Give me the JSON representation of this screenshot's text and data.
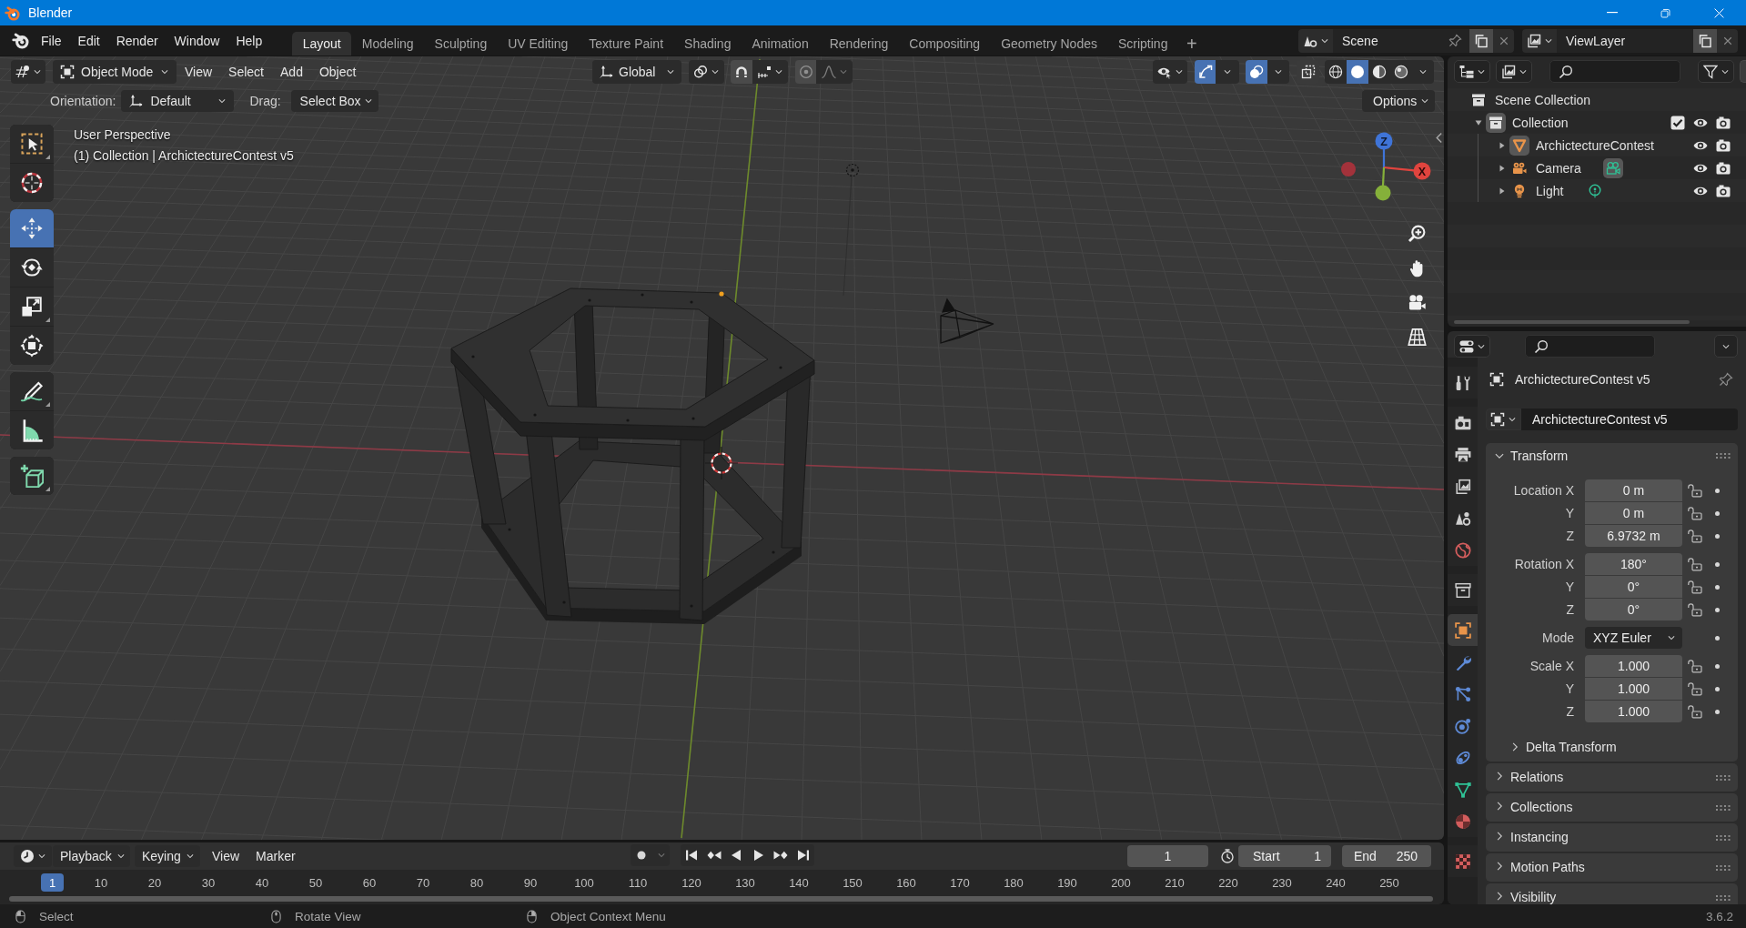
{
  "window": {
    "title": "Blender"
  },
  "menu": [
    "File",
    "Edit",
    "Render",
    "Window",
    "Help"
  ],
  "workspaces": [
    {
      "label": "Layout",
      "selected": true
    },
    {
      "label": "Modeling",
      "selected": false
    },
    {
      "label": "Sculpting",
      "selected": false
    },
    {
      "label": "UV Editing",
      "selected": false
    },
    {
      "label": "Texture Paint",
      "selected": false
    },
    {
      "label": "Shading",
      "selected": false
    },
    {
      "label": "Animation",
      "selected": false
    },
    {
      "label": "Rendering",
      "selected": false
    },
    {
      "label": "Compositing",
      "selected": false
    },
    {
      "label": "Geometry Nodes",
      "selected": false
    },
    {
      "label": "Scripting",
      "selected": false
    }
  ],
  "add_workspace": "+",
  "scene": {
    "name": "Scene"
  },
  "view_layer": {
    "name": "ViewLayer"
  },
  "viewport": {
    "header": {
      "mode": "Object Mode",
      "menus": [
        "View",
        "Select",
        "Add",
        "Object"
      ],
      "orientation": "Global",
      "gizmos_on": true,
      "overlays_on": true,
      "xray_on": false,
      "shading": [
        {
          "kind": "wireframe",
          "selected": false
        },
        {
          "kind": "solid",
          "selected": true
        },
        {
          "kind": "material",
          "selected": false
        },
        {
          "kind": "rendered",
          "selected": false
        }
      ]
    },
    "tool_settings": {
      "orientation_label": "Orientation:",
      "orientation": "Default",
      "drag_label": "Drag:",
      "drag": "Select Box",
      "options": "Options"
    },
    "tool_groups": [
      {
        "tools": [
          {
            "kind": "select_box",
            "selected": false,
            "submenu": true
          },
          {
            "kind": "cursor",
            "selected": false,
            "submenu": false
          }
        ]
      },
      {
        "tools": [
          {
            "kind": "move",
            "selected": true,
            "submenu": false
          },
          {
            "kind": "rotate",
            "selected": false,
            "submenu": false
          },
          {
            "kind": "scale",
            "selected": false,
            "submenu": true
          },
          {
            "kind": "transform",
            "selected": false,
            "submenu": false
          }
        ]
      },
      {
        "tools": [
          {
            "kind": "annotate",
            "selected": false,
            "submenu": true
          },
          {
            "kind": "measure",
            "selected": false,
            "submenu": false
          }
        ]
      },
      {
        "tools": [
          {
            "kind": "add_cube",
            "selected": false,
            "submenu": true
          }
        ]
      }
    ],
    "view_name": "User Perspective",
    "view_info": "(1) Collection | ArchictectureContest v5",
    "gizmo": {
      "x_label": "X",
      "z_label": "Z"
    }
  },
  "outliner": {
    "root": "Scene Collection",
    "items": [
      {
        "name": "Collection",
        "kind": "collection",
        "active": true,
        "expanded": true,
        "checked": true,
        "visible": true,
        "renderable": true,
        "children": [
          {
            "name": "ArchictectureContest",
            "kind": "mesh",
            "active": true,
            "expanded": false,
            "visible": true,
            "renderable": true
          },
          {
            "name": "Camera",
            "kind": "camera",
            "active": false,
            "expanded": false,
            "visible": true,
            "renderable": true,
            "data_active": true
          },
          {
            "name": "Light",
            "kind": "light",
            "active": false,
            "expanded": false,
            "visible": true,
            "renderable": true,
            "data_active": false
          }
        ]
      }
    ]
  },
  "properties": {
    "tab_groups": [
      {
        "tabs": [
          {
            "kind": "tool",
            "selected": false
          }
        ]
      },
      {
        "tabs": [
          {
            "kind": "render",
            "selected": false
          },
          {
            "kind": "output",
            "selected": false
          },
          {
            "kind": "view_layer",
            "selected": false
          },
          {
            "kind": "scene",
            "selected": false
          },
          {
            "kind": "world",
            "selected": false
          }
        ]
      },
      {
        "tabs": [
          {
            "kind": "collection",
            "selected": false
          }
        ]
      },
      {
        "tabs": [
          {
            "kind": "object",
            "selected": true
          },
          {
            "kind": "modifiers",
            "selected": false
          },
          {
            "kind": "particles",
            "selected": false
          },
          {
            "kind": "physics",
            "selected": false
          },
          {
            "kind": "constraints",
            "selected": false
          },
          {
            "kind": "data",
            "selected": false
          },
          {
            "kind": "material",
            "selected": false
          }
        ]
      },
      {
        "tabs": [
          {
            "kind": "texture",
            "selected": false
          }
        ]
      }
    ],
    "object_name": "ArchictectureContest v5",
    "datablock": "ArchictectureContest v5",
    "transform": {
      "title": "Transform",
      "expanded": true,
      "groups": [
        {
          "rows": [
            {
              "label": "Location X",
              "value": "0 m",
              "kind": "number",
              "locked": false
            },
            {
              "label": "Y",
              "value": "0 m",
              "kind": "number",
              "locked": false
            },
            {
              "label": "Z",
              "value": "6.9732 m",
              "kind": "number",
              "locked": false
            }
          ]
        },
        {
          "rows": [
            {
              "label": "Rotation X",
              "value": "180°",
              "kind": "number",
              "locked": false
            },
            {
              "label": "Y",
              "value": "0°",
              "kind": "number",
              "locked": false
            },
            {
              "label": "Z",
              "value": "0°",
              "kind": "number",
              "locked": false
            }
          ]
        },
        {
          "rows": [
            {
              "label": "Mode",
              "value": "XYZ Euler",
              "kind": "dropdown"
            }
          ]
        },
        {
          "rows": [
            {
              "label": "Scale X",
              "value": "1.000",
              "kind": "number",
              "locked": false
            },
            {
              "label": "Y",
              "value": "1.000",
              "kind": "number",
              "locked": false
            },
            {
              "label": "Z",
              "value": "1.000",
              "kind": "number",
              "locked": false
            }
          ]
        }
      ],
      "subpanels": [
        {
          "title": "Delta Transform",
          "expanded": false
        }
      ]
    },
    "panels": [
      {
        "title": "Relations",
        "expanded": false
      },
      {
        "title": "Collections",
        "expanded": false
      },
      {
        "title": "Instancing",
        "expanded": false
      },
      {
        "title": "Motion Paths",
        "expanded": false
      },
      {
        "title": "Visibility",
        "expanded": false
      }
    ]
  },
  "timeline": {
    "menus": [
      {
        "label": "Playback",
        "kind": "dropdown"
      },
      {
        "label": "Keying",
        "kind": "dropdown"
      },
      {
        "label": "View",
        "kind": "menu"
      },
      {
        "label": "Marker",
        "kind": "menu"
      }
    ],
    "auto_keying": false,
    "current_frame": "1",
    "start_label": "Start",
    "start": "1",
    "end_label": "End",
    "end": "250",
    "playhead": "1",
    "ticks": [
      "10",
      "20",
      "30",
      "40",
      "50",
      "60",
      "70",
      "80",
      "90",
      "100",
      "110",
      "120",
      "130",
      "140",
      "150",
      "160",
      "170",
      "180",
      "190",
      "200",
      "210",
      "220",
      "230",
      "240",
      "250"
    ]
  },
  "status_bar": {
    "hints": [
      {
        "kind": "left_click",
        "label": "Select"
      },
      {
        "kind": "middle_click",
        "label": "Rotate View"
      },
      {
        "kind": "right_click",
        "label": "Object Context Menu"
      }
    ],
    "version": "3.6.2"
  }
}
